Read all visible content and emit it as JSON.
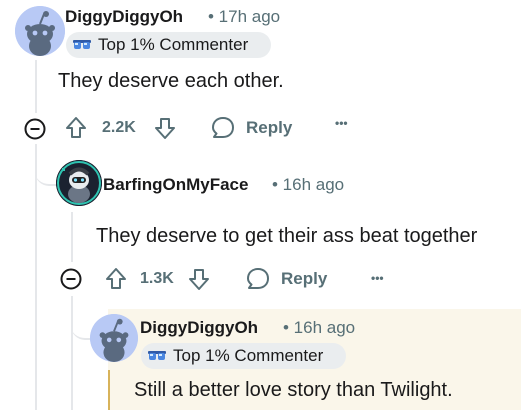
{
  "comments": [
    {
      "username": "DiggyDiggyOh",
      "time": "• 17h ago",
      "badge": "Top 1% Commenter",
      "body": "They deserve each other.",
      "votes": "2.2K",
      "reply_label": "Reply",
      "more_label": "•••"
    },
    {
      "username": "BarfingOnMyFace",
      "time": "• 16h ago",
      "body": "They deserve to get their ass beat together",
      "votes": "1.3K",
      "reply_label": "Reply",
      "more_label": "•••"
    },
    {
      "username": "DiggyDiggyOh",
      "time": "• 16h ago",
      "badge": "Top 1% Commenter",
      "body": "Still a better love story than Twilight."
    }
  ],
  "colors": {
    "meta_gray": "#576f76",
    "thread_line": "#e5e7ea",
    "badge_bg": "#eaedef",
    "highlight_bg": "#faf6ea",
    "highlight_bar": "#d8b35a",
    "snoo_bg": "#b8c9f5"
  },
  "icons": {
    "collapse": "minus-circle-icon",
    "upvote": "upvote-arrow-icon",
    "downvote": "downvote-arrow-icon",
    "reply": "speech-bubble-icon",
    "badge": "sunglasses-icon",
    "avatar_default": "snoo-icon"
  }
}
